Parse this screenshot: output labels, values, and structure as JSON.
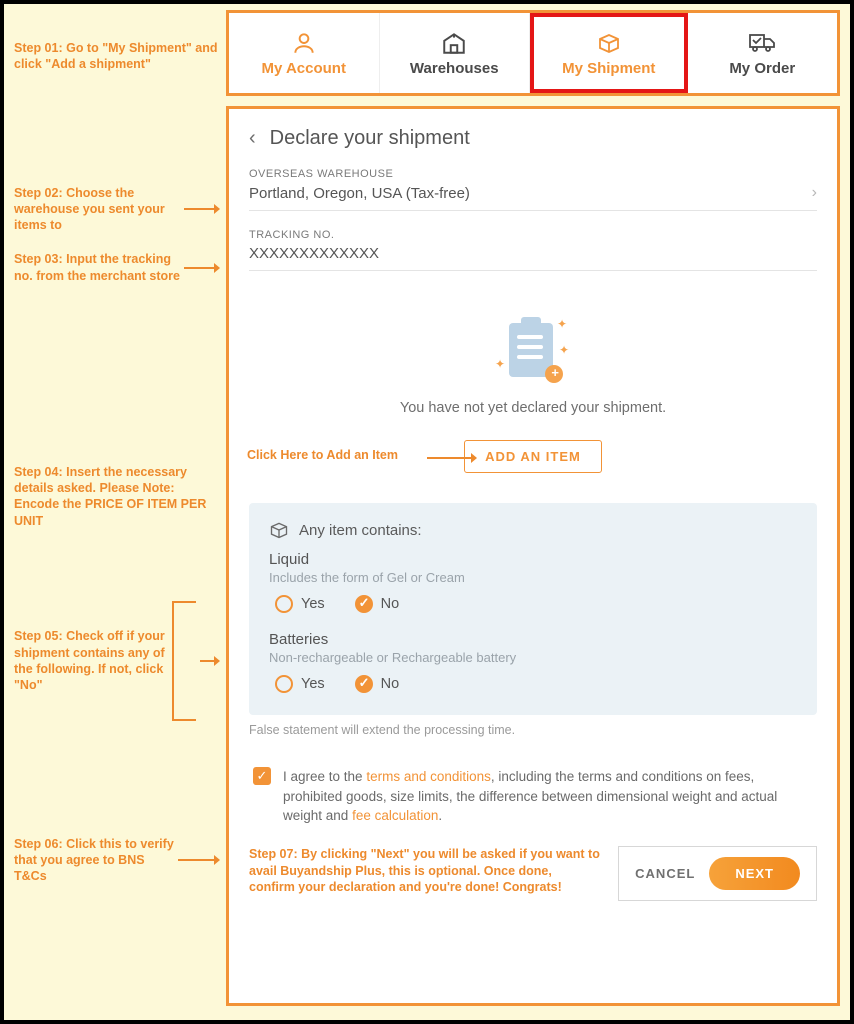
{
  "nav": {
    "items": [
      {
        "label": "My Account",
        "icon": "person-icon",
        "active": true
      },
      {
        "label": "Warehouses",
        "icon": "warehouse-icon",
        "active": false
      },
      {
        "label": "My Shipment",
        "icon": "box-icon",
        "active": true,
        "highlight": true
      },
      {
        "label": "My Order",
        "icon": "truck-icon",
        "active": false
      }
    ]
  },
  "steps": {
    "s1": "Step 01: Go to \"My Shipment\" and click \"Add a shipment\"",
    "s2": "Step 02: Choose the warehouse you sent your items to",
    "s3": "Step 03: Input the tracking no. from the merchant store",
    "s4": "Step 04: Insert the necessary details asked. Please Note: Encode the PRICE OF ITEM PER UNIT",
    "s5": "Step 05: Check off if your shipment contains any of the following. If not, click \"No\"",
    "s6": "Step 06: Click this to verify that you agree to BNS T&Cs",
    "s7": "Step 07: By clicking \"Next\" you will be asked if you want to avail Buyandship Plus, this is optional. Once done, confirm your declaration and you're done! Congrats!"
  },
  "panel": {
    "title": "Declare your shipment",
    "warehouse_label": "OVERSEAS WAREHOUSE",
    "warehouse_value": "Portland, Oregon, USA (Tax-free)",
    "tracking_label": "TRACKING NO.",
    "tracking_value": "XXXXXXXXXXXXX",
    "empty_text": "You have not yet declared your shipment.",
    "add_inline": "Click Here to Add an Item",
    "add_button": "ADD AN ITEM",
    "contains_title": "Any item contains:",
    "q1_label": "Liquid",
    "q1_sub": "Includes the form of Gel or Cream",
    "q2_label": "Batteries",
    "q2_sub": "Non-rechargeable or Rechargeable battery",
    "yes": "Yes",
    "no": "No",
    "false_note": "False statement will extend the processing time.",
    "agree_pre": "I agree to the ",
    "agree_link1": "terms and conditions",
    "agree_mid": ", including the terms and conditions on fees, prohibited goods, size limits, the difference between dimensional weight and actual weight and ",
    "agree_link2": "fee calculation",
    "agree_post": ".",
    "cancel": "CANCEL",
    "next": "NEXT"
  },
  "colors": {
    "accent": "#f29337",
    "highlight_red": "#e41616"
  }
}
